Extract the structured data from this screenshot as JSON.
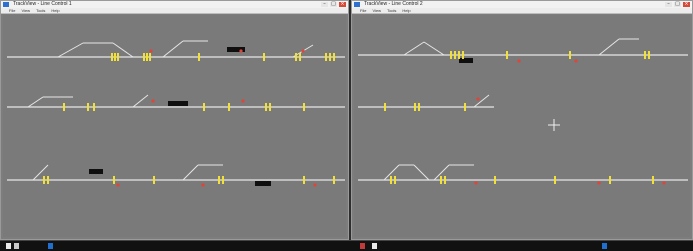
{
  "colors": {
    "canvas": "#7a7a7a",
    "track": "#e6e6e6",
    "signal_yellow": "#f1e03a",
    "signal_red": "#e0453a",
    "label_box": "#0f0f0f"
  },
  "windows": [
    {
      "title": "TrackView - Line Control 1",
      "menus": [
        "File",
        "View",
        "Tools",
        "Help"
      ],
      "icon": "app-icon"
    },
    {
      "title": "TrackView - Line Control 2",
      "menus": [
        "File",
        "View",
        "Tools",
        "Help"
      ],
      "icon": "app-icon"
    }
  ],
  "taskbar": {
    "items": [
      "start-icon",
      "app-icon",
      "app-icon",
      "app-icon",
      "app-icon",
      "app-icon"
    ]
  }
}
